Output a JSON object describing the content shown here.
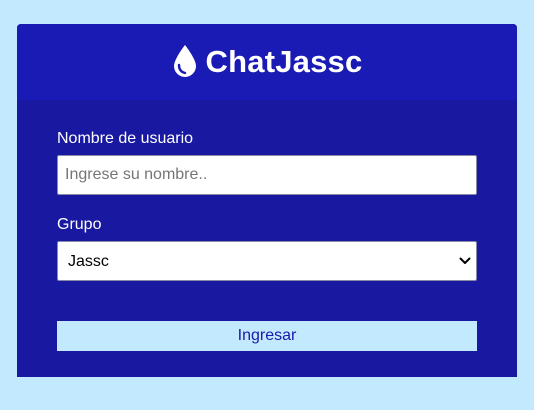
{
  "header": {
    "icon": "droplet-icon",
    "title": "ChatJassc"
  },
  "form": {
    "username": {
      "label": "Nombre de usuario",
      "value": "",
      "placeholder": "Ingrese su nombre.."
    },
    "group": {
      "label": "Grupo",
      "selected": "Jassc"
    },
    "submit_label": "Ingresar"
  },
  "colors": {
    "page_background": "#c2e9fd",
    "card_background": "#1818a0",
    "header_background": "#1a1ab4",
    "button_text": "#1a1aa8"
  }
}
